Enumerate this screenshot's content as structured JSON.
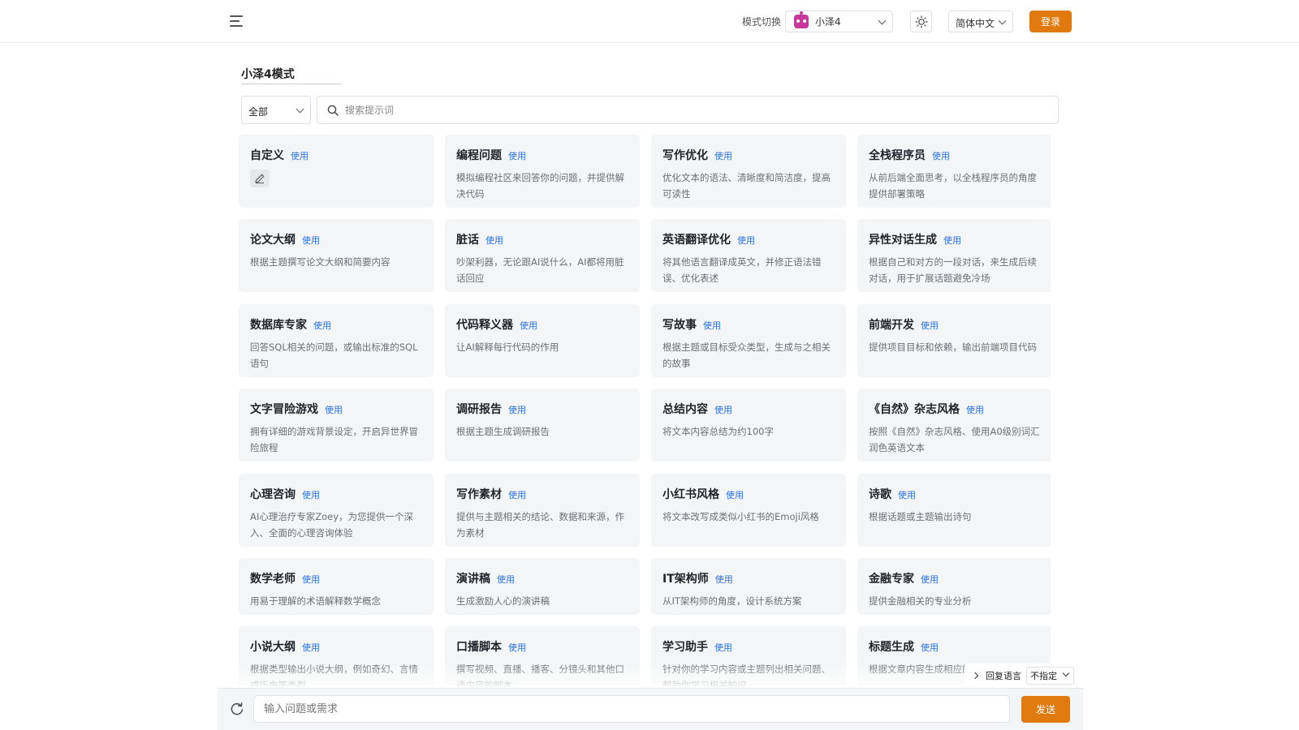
{
  "header": {
    "mode_switch_label": "模式切换",
    "model": {
      "value": "小泽4",
      "icon": "robot-icon"
    },
    "theme_icon": "sun-icon",
    "language": "简体中文",
    "login_label": "登录",
    "accent_color": "#e07a0e"
  },
  "main": {
    "section_title": "小泽4模式",
    "category_filter": "全部",
    "search_placeholder": "搜索提示词"
  },
  "use_label": "使用",
  "cards": [
    {
      "title": "自定义",
      "desc": "",
      "editable": true
    },
    {
      "title": "编程问题",
      "desc": "模拟编程社区来回答你的问题，并提供解决代码"
    },
    {
      "title": "写作优化",
      "desc": "优化文本的语法、清晰度和简洁度，提高可读性"
    },
    {
      "title": "全栈程序员",
      "desc": "从前后端全面思考，以全栈程序员的角度提供部署策略"
    },
    {
      "title": "论文大纲",
      "desc": "根据主题撰写论文大纲和简要内容"
    },
    {
      "title": "脏话",
      "desc": "吵架利器，无论跟AI说什么，AI都将用脏话回应"
    },
    {
      "title": "英语翻译优化",
      "desc": "将其他语言翻译成英文，并修正语法错误、优化表述"
    },
    {
      "title": "异性对话生成",
      "desc": "根据自己和对方的一段对话，来生成后续对话，用于扩展话题避免冷场"
    },
    {
      "title": "数据库专家",
      "desc": "回答SQL相关的问题，或输出标准的SQL语句"
    },
    {
      "title": "代码释义器",
      "desc": "让AI解释每行代码的作用"
    },
    {
      "title": "写故事",
      "desc": "根据主题或目标受众类型，生成与之相关的故事"
    },
    {
      "title": "前端开发",
      "desc": "提供项目目标和依赖，输出前端项目代码"
    },
    {
      "title": "文字冒险游戏",
      "desc": "拥有详细的游戏背景设定，开启异世界冒险旅程"
    },
    {
      "title": "调研报告",
      "desc": "根据主题生成调研报告"
    },
    {
      "title": "总结内容",
      "desc": "将文本内容总结为约100字"
    },
    {
      "title": "《自然》杂志风格",
      "desc": "按照《自然》杂志风格、使用A0级别词汇润色英语文本"
    },
    {
      "title": "心理咨询",
      "desc": "AI心理治疗专家Zoey，为您提供一个深入、全面的心理咨询体验"
    },
    {
      "title": "写作素材",
      "desc": "提供与主题相关的结论、数据和来源，作为素材"
    },
    {
      "title": "小红书风格",
      "desc": "将文本改写成类似小红书的Emoji风格"
    },
    {
      "title": "诗歌",
      "desc": "根据话题或主题输出诗句"
    },
    {
      "title": "数学老师",
      "desc": "用易于理解的术语解释数学概念"
    },
    {
      "title": "演讲稿",
      "desc": "生成激励人心的演讲稿"
    },
    {
      "title": "IT架构师",
      "desc": "从IT架构师的角度，设计系统方案"
    },
    {
      "title": "金融专家",
      "desc": "提供金融相关的专业分析"
    },
    {
      "title": "小说大纲",
      "desc": "根据类型输出小说大纲，例如奇幻、言情或历史等类型"
    },
    {
      "title": "口播脚本",
      "desc": "撰写视频、直播、播客、分镜头和其他口语内容的脚本"
    },
    {
      "title": "学习助手",
      "desc": "针对你的学习内容或主题列出相关问题、帮助你学习相关知识"
    },
    {
      "title": "标题生成",
      "desc": "根据文章内容生成相应的标题"
    }
  ],
  "reply_language": {
    "label": "回复语言",
    "value": "不指定"
  },
  "composer": {
    "placeholder": "输入问题或需求",
    "send_label": "发送",
    "refresh_icon": "refresh-icon"
  }
}
